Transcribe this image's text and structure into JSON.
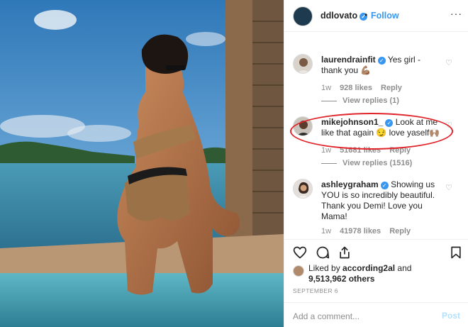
{
  "post": {
    "author": "ddlovato",
    "follow_separator": "•",
    "follow_label": "Follow",
    "more_label": "···"
  },
  "comments": [
    {
      "username": "laurendrainfit",
      "text": "Yes girl - thank you 💪🏽",
      "time": "1w",
      "likes": "928 likes",
      "reply_label": "Reply",
      "view_replies": "View replies (1)"
    },
    {
      "username": "mikejohnson1_",
      "text": "Look at me like that again 😏 love yaself🙌🏽",
      "time": "1w",
      "likes": "51681 likes",
      "reply_label": "Reply",
      "view_replies": "View replies (1516)"
    },
    {
      "username": "ashleygraham",
      "text": "Showing us YOU is so incredibly beautiful. Thank you Demi! Love you Mama!",
      "time": "1w",
      "likes": "41978 likes",
      "reply_label": "Reply"
    }
  ],
  "likes": {
    "prefix": "Liked by",
    "by": "according2al",
    "conjunction": "and",
    "count": "9,513,962 others"
  },
  "date": "SEPTEMBER 6",
  "add_comment": {
    "placeholder": "Add a comment...",
    "post_label": "Post"
  },
  "colors": {
    "link_blue": "#3897f0",
    "highlight_red": "#e0242a",
    "muted_text": "#8e8e8e",
    "post_disabled": "#b2dffc"
  },
  "icons": [
    "verified-badge",
    "heart-icon",
    "comment-icon",
    "share-icon",
    "bookmark-icon"
  ]
}
